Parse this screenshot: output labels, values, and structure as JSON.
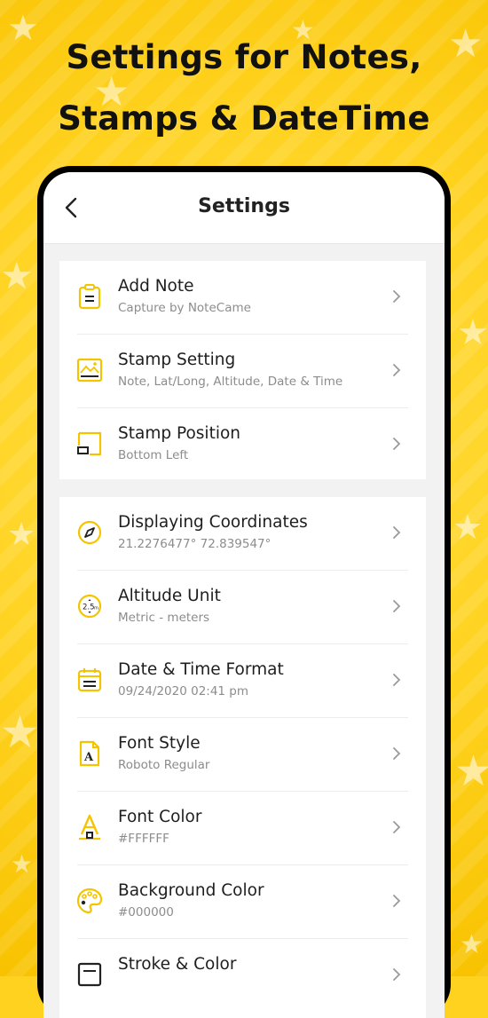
{
  "headline": {
    "line1": "Settings for Notes,",
    "line2": "Stamps & DateTime"
  },
  "appbar": {
    "title": "Settings",
    "back_icon": "chevron-left-icon"
  },
  "group1": [
    {
      "label": "Add Note",
      "sub": "Capture by NoteCame",
      "icon": "note-icon"
    },
    {
      "label": "Stamp Setting",
      "sub": "Note, Lat/Long, Altitude, Date & Time",
      "icon": "image-stamp-icon"
    },
    {
      "label": "Stamp Position",
      "sub": "Bottom Left",
      "icon": "position-icon"
    }
  ],
  "group2": [
    {
      "label": "Displaying Coordinates",
      "sub": "21.2276477° 72.839547°",
      "icon": "compass-icon"
    },
    {
      "label": "Altitude Unit",
      "sub": "Metric - meters",
      "icon": "altitude-icon"
    },
    {
      "label": "Date & Time Format",
      "sub": "09/24/2020 02:41 pm",
      "icon": "calendar-icon"
    },
    {
      "label": "Font Style",
      "sub": "Roboto Regular",
      "icon": "font-file-icon"
    },
    {
      "label": "Font Color",
      "sub": "#FFFFFF",
      "icon": "font-color-icon"
    },
    {
      "label": "Background Color",
      "sub": "#000000",
      "icon": "palette-icon"
    },
    {
      "label": "Stroke & Color",
      "sub": "",
      "icon": "stroke-icon"
    }
  ],
  "colors": {
    "accent": "#F5C400",
    "background": "#FFD21F",
    "icon_dark": "#222222"
  }
}
